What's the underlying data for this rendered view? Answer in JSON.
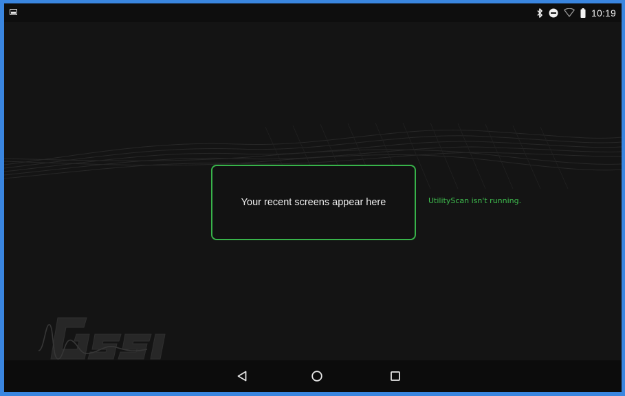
{
  "status_bar": {
    "notification_icon": "image-icon",
    "icons": [
      "bluetooth-icon",
      "do-not-disturb-icon",
      "wifi-icon",
      "battery-icon"
    ],
    "time": "10:19"
  },
  "recents": {
    "placeholder_text": "Your recent screens appear here",
    "app_status": "UtilityScan isn't running."
  },
  "branding": {
    "logo": "GSSI",
    "accent_color": "#38b34a"
  },
  "nav_bar": {
    "buttons": [
      "back-icon",
      "home-icon",
      "recents-icon"
    ]
  }
}
